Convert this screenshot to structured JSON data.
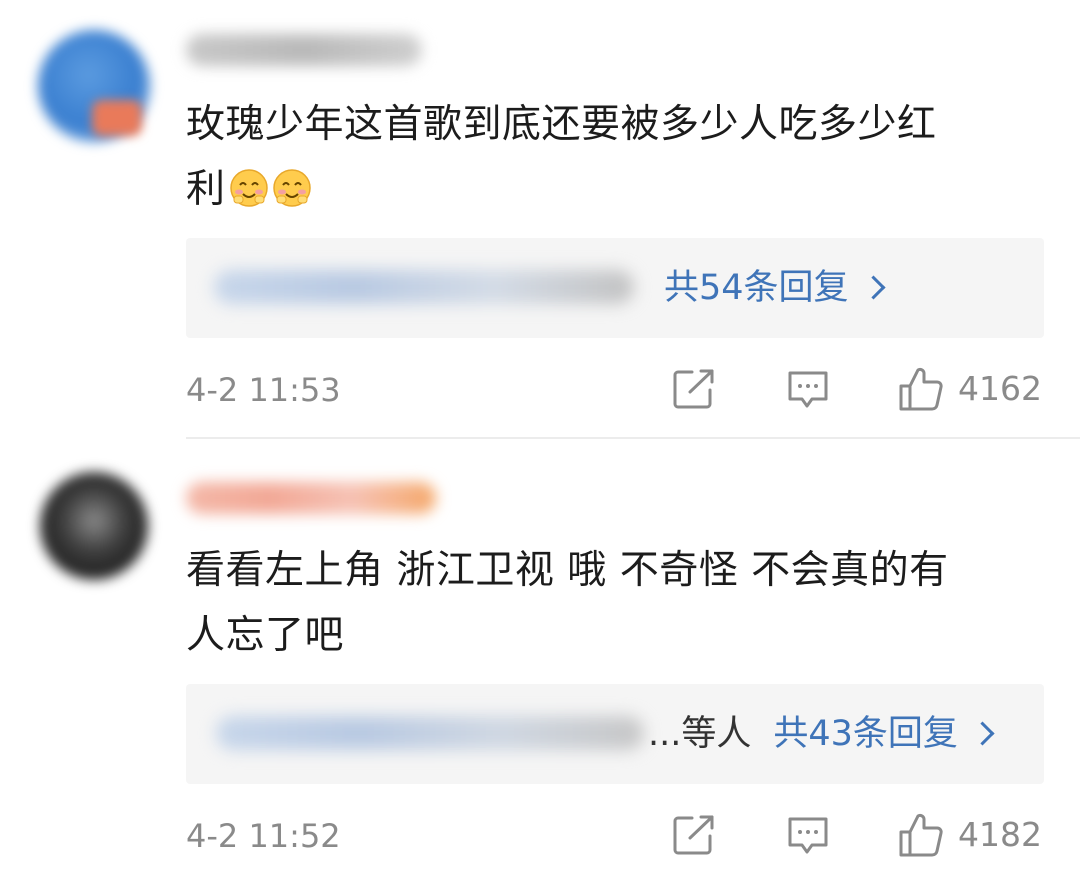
{
  "comments": [
    {
      "username": "",
      "text_line1": "玫瑰少年这首歌到底还要被多少人吃多少红",
      "text_line2": "利",
      "emoji": [
        "blush-emoji",
        "blush-emoji"
      ],
      "reply_prefix": "",
      "reply_count": "共54条回复",
      "time": "4-2 11:53",
      "likes": "4162"
    },
    {
      "username": "",
      "text_line1": "看看左上角 浙江卫视 哦 不奇怪 不会真的有",
      "text_line2": "人忘了吧",
      "reply_prefix": "...等人",
      "reply_count": "共43条回复",
      "time": "4-2 11:52",
      "likes": "4182"
    }
  ],
  "icons": {
    "share": "share-icon",
    "comment": "comment-icon",
    "like": "thumbs-up-icon",
    "chevron": "chevron-right-icon"
  },
  "colors": {
    "link_blue": "#3f74b8",
    "meta_gray": "#8a8a8a",
    "reply_bg": "#f5f5f5"
  }
}
